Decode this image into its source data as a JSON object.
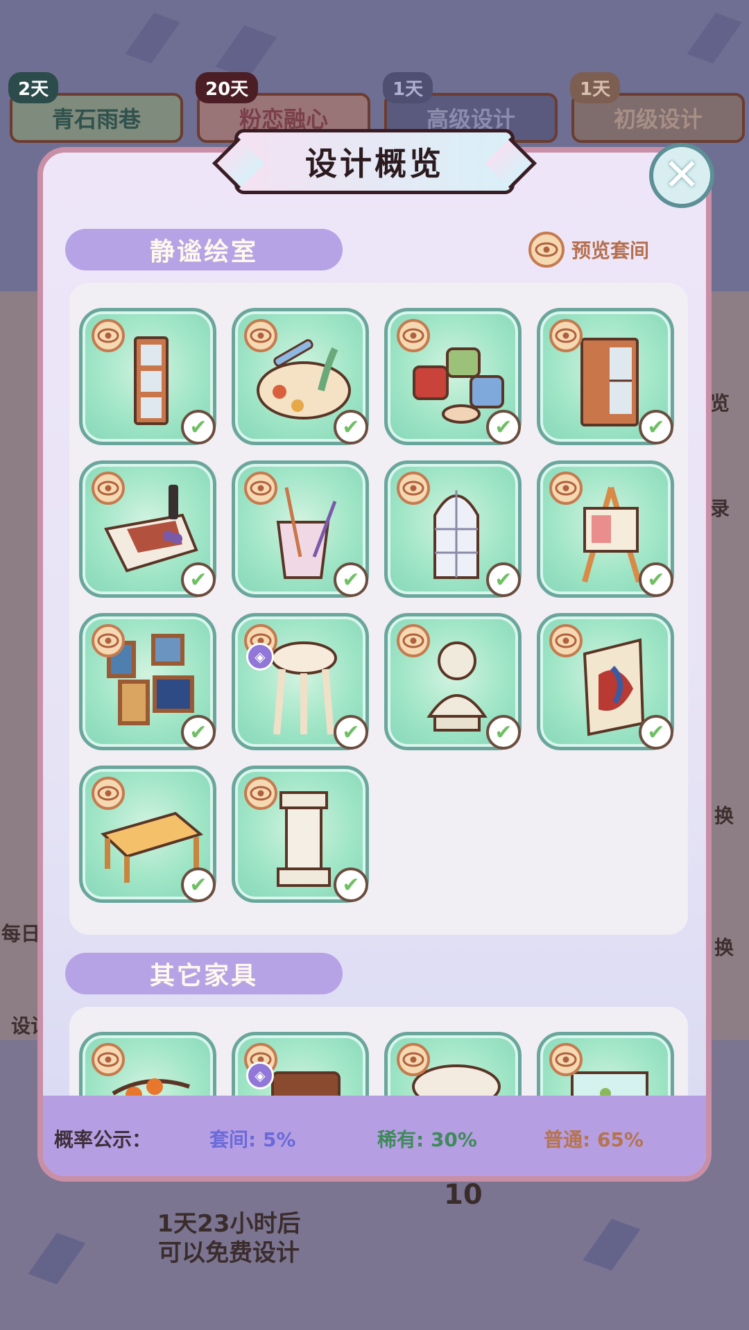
{
  "background": {
    "room_tabs": [
      {
        "days": "2天",
        "name": "青石雨巷"
      },
      {
        "days": "20天",
        "name": "粉恋融心"
      },
      {
        "days": "1天",
        "name": "高级设计"
      },
      {
        "days": "1天",
        "name": "初级设计"
      }
    ],
    "side_texts": [
      "览",
      "录",
      "换",
      "换",
      "每日",
      "设计"
    ],
    "free_design_text_line1": "1天23小时后",
    "free_design_text_line2": "可以免费设计",
    "count_label": "10"
  },
  "dialog": {
    "title": "设计概览",
    "close_icon": "close-x-icon",
    "section1_title": "静谧绘室",
    "preview_label": "预览套间",
    "section1_items": [
      {
        "name": "bookshelf-narrow",
        "checked": true,
        "special": false
      },
      {
        "name": "paint-palette",
        "checked": true,
        "special": false
      },
      {
        "name": "paint-jars",
        "checked": true,
        "special": false
      },
      {
        "name": "cabinet",
        "checked": true,
        "special": false
      },
      {
        "name": "still-life-table",
        "checked": true,
        "special": false
      },
      {
        "name": "brush-cup",
        "checked": true,
        "special": false
      },
      {
        "name": "arched-window",
        "checked": true,
        "special": false
      },
      {
        "name": "easel",
        "checked": true,
        "special": false
      },
      {
        "name": "picture-frames",
        "checked": true,
        "special": false
      },
      {
        "name": "stool",
        "checked": true,
        "special": true
      },
      {
        "name": "plaster-bust",
        "checked": true,
        "special": false
      },
      {
        "name": "abstract-painting",
        "checked": true,
        "special": false
      },
      {
        "name": "wooden-table",
        "checked": true,
        "special": false
      },
      {
        "name": "column-pedestal",
        "checked": true,
        "special": false
      }
    ],
    "section2_title": "其它家具",
    "section2_items": [
      {
        "name": "persimmon-branch",
        "special": false
      },
      {
        "name": "radio",
        "special": true
      },
      {
        "name": "round-table",
        "special": false
      },
      {
        "name": "aquarium",
        "special": false
      }
    ],
    "probability": {
      "label": "概率公示：",
      "suite": "套间: 5%",
      "rare": "稀有: 30%",
      "common": "普通: 65%"
    },
    "colors": {
      "suite": "#6a6ad8",
      "rare": "#3f8a5a",
      "common": "#b5744e"
    }
  }
}
